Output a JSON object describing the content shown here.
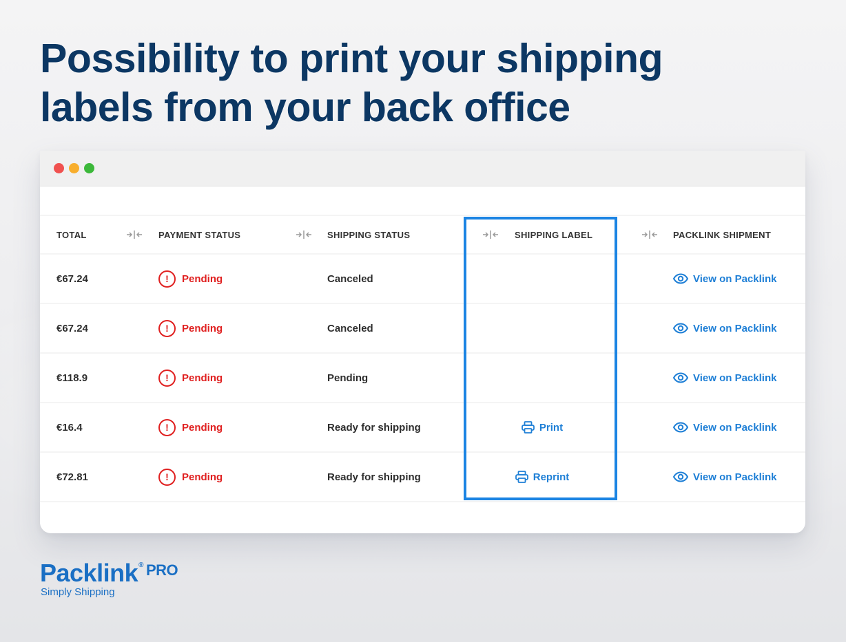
{
  "headline": {
    "line1": "Possibility to print your shipping",
    "line2": "labels from your back office"
  },
  "window": {
    "controls": [
      "close",
      "minimize",
      "maximize"
    ]
  },
  "table": {
    "columns": [
      {
        "key": "total",
        "label": "TOTAL"
      },
      {
        "key": "payment_status",
        "label": "PAYMENT STATUS"
      },
      {
        "key": "shipping_status",
        "label": "SHIPPING STATUS"
      },
      {
        "key": "shipping_label",
        "label": "SHIPPING LABEL"
      },
      {
        "key": "packlink_shipment",
        "label": "PACKLINK SHIPMENT"
      }
    ],
    "rows": [
      {
        "total": "€67.24",
        "payment_status": "Pending",
        "shipping_status": "Canceled",
        "shipping_label": "",
        "packlink_shipment": "View on Packlink"
      },
      {
        "total": "€67.24",
        "payment_status": "Pending",
        "shipping_status": "Canceled",
        "shipping_label": "",
        "packlink_shipment": "View on Packlink"
      },
      {
        "total": "€118.9",
        "payment_status": "Pending",
        "shipping_status": "Pending",
        "shipping_label": "",
        "packlink_shipment": "View on Packlink"
      },
      {
        "total": "€16.4",
        "payment_status": "Pending",
        "shipping_status": "Ready for shipping",
        "shipping_label": "Print",
        "packlink_shipment": "View on Packlink"
      },
      {
        "total": "€72.81",
        "payment_status": "Pending",
        "shipping_status": "Ready for shipping",
        "shipping_label": "Reprint",
        "packlink_shipment": "View on Packlink"
      }
    ],
    "alert_glyph": "!"
  },
  "logo": {
    "name": "Packlink",
    "reg": "®",
    "pro": "PRO",
    "tagline": "Simply Shipping"
  },
  "colors": {
    "headline": "#0c3763",
    "accent": "#1e7fd6",
    "highlight": "#1b84e3",
    "pending": "#e02020"
  }
}
